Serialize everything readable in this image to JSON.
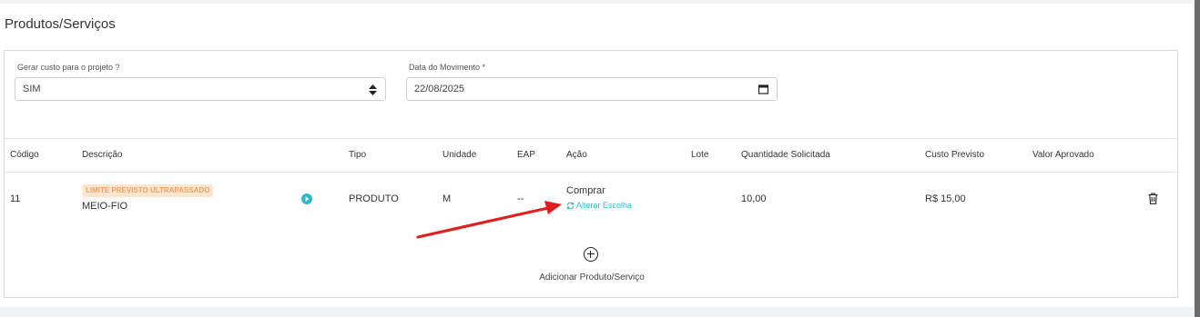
{
  "section": {
    "title": "Produtos/Serviços"
  },
  "form": {
    "gerar_custo": {
      "label": "Gerar custo para o projeto ?",
      "value": "SIM"
    },
    "data_movimento": {
      "label": "Data do Movimento *",
      "value": "22/08/2025"
    }
  },
  "table": {
    "headers": {
      "codigo": "Código",
      "descricao": "Descrição",
      "tipo": "Tipo",
      "unidade": "Unidade",
      "eap": "EAP",
      "acao": "Ação",
      "lote": "Lote",
      "quantidade": "Quantidade Solicitada",
      "custo": "Custo Previsto",
      "valor": "Valor Aprovado"
    },
    "row": {
      "codigo": "11",
      "badge": "LIMITE PREVISTO ULTRAPASSADO",
      "descricao": "MEIO-FIO",
      "tipo": "PRODUTO",
      "unidade": "M",
      "eap": "--",
      "acao": "Comprar",
      "alterar": "Alterar Escolha",
      "quantidade": "10,00",
      "custo": "R$ 15,00",
      "valor": ""
    }
  },
  "actions": {
    "add_label": "Adicionar Produto/Serviço"
  },
  "colors": {
    "accent": "#2fb7cc",
    "badge_bg": "#fde6cf",
    "badge_text": "#f0a060",
    "arrow": "#e02020"
  },
  "icons": [
    "sort-arrows-icon",
    "calendar-icon",
    "play-circle-icon",
    "refresh-icon",
    "trash-icon",
    "plus-circle-icon"
  ]
}
